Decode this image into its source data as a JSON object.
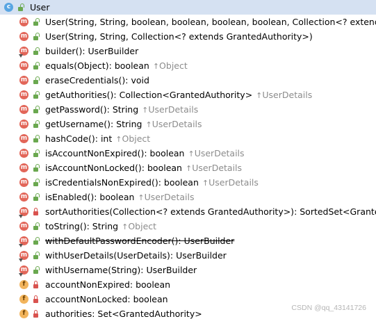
{
  "header": {
    "class_name": "User",
    "icon": "class-icon"
  },
  "members": [
    {
      "kind": "m",
      "visibility": "public",
      "override": false,
      "text": "User(String, String, boolean, boolean, boolean, boolean, Collection<? extends GrantedAuthority>)",
      "strike": false,
      "inherits": ""
    },
    {
      "kind": "m",
      "visibility": "public",
      "override": false,
      "text": "User(String, String, Collection<? extends GrantedAuthority>)",
      "strike": false,
      "inherits": ""
    },
    {
      "kind": "m",
      "visibility": "public",
      "override": true,
      "text": "builder(): UserBuilder",
      "strike": false,
      "inherits": ""
    },
    {
      "kind": "m",
      "visibility": "public",
      "override": false,
      "text": "equals(Object): boolean",
      "strike": false,
      "inherits": "Object"
    },
    {
      "kind": "m",
      "visibility": "public",
      "override": false,
      "text": "eraseCredentials(): void",
      "strike": false,
      "inherits": ""
    },
    {
      "kind": "m",
      "visibility": "public",
      "override": false,
      "text": "getAuthorities(): Collection<GrantedAuthority>",
      "strike": false,
      "inherits": "UserDetails"
    },
    {
      "kind": "m",
      "visibility": "public",
      "override": false,
      "text": "getPassword(): String",
      "strike": false,
      "inherits": "UserDetails"
    },
    {
      "kind": "m",
      "visibility": "public",
      "override": false,
      "text": "getUsername(): String",
      "strike": false,
      "inherits": "UserDetails"
    },
    {
      "kind": "m",
      "visibility": "public",
      "override": false,
      "text": "hashCode(): int",
      "strike": false,
      "inherits": "Object"
    },
    {
      "kind": "m",
      "visibility": "public",
      "override": false,
      "text": "isAccountNonExpired(): boolean",
      "strike": false,
      "inherits": "UserDetails"
    },
    {
      "kind": "m",
      "visibility": "public",
      "override": false,
      "text": "isAccountNonLocked(): boolean",
      "strike": false,
      "inherits": "UserDetails"
    },
    {
      "kind": "m",
      "visibility": "public",
      "override": false,
      "text": "isCredentialsNonExpired(): boolean",
      "strike": false,
      "inherits": "UserDetails"
    },
    {
      "kind": "m",
      "visibility": "public",
      "override": false,
      "text": "isEnabled(): boolean",
      "strike": false,
      "inherits": "UserDetails"
    },
    {
      "kind": "m",
      "visibility": "private",
      "override": true,
      "text": "sortAuthorities(Collection<? extends GrantedAuthority>): SortedSet<GrantedAuthority>",
      "strike": false,
      "inherits": ""
    },
    {
      "kind": "m",
      "visibility": "public",
      "override": false,
      "text": "toString(): String",
      "strike": false,
      "inherits": "Object"
    },
    {
      "kind": "m",
      "visibility": "public",
      "override": true,
      "text": "withDefaultPasswordEncoder(): UserBuilder",
      "strike": true,
      "inherits": ""
    },
    {
      "kind": "m",
      "visibility": "public",
      "override": true,
      "text": "withUserDetails(UserDetails): UserBuilder",
      "strike": false,
      "inherits": ""
    },
    {
      "kind": "m",
      "visibility": "public",
      "override": true,
      "text": "withUsername(String): UserBuilder",
      "strike": false,
      "inherits": ""
    },
    {
      "kind": "f",
      "visibility": "private",
      "override": false,
      "text": "accountNonExpired: boolean",
      "strike": false,
      "inherits": ""
    },
    {
      "kind": "f",
      "visibility": "private",
      "override": false,
      "text": "accountNonLocked: boolean",
      "strike": false,
      "inherits": ""
    },
    {
      "kind": "f",
      "visibility": "private",
      "override": false,
      "text": "authorities: Set<GrantedAuthority>",
      "strike": false,
      "inherits": ""
    }
  ],
  "inherit_arrow": "↑",
  "watermark": "CSDN @qq_43141726",
  "colors": {
    "header_bg": "#d5e1f2",
    "method_badge": "#e26659",
    "field_badge": "#f2b45c",
    "public_visibility": "#6aa84f",
    "private_visibility": "#d9534f",
    "inherited_text": "#8c8c8c"
  }
}
